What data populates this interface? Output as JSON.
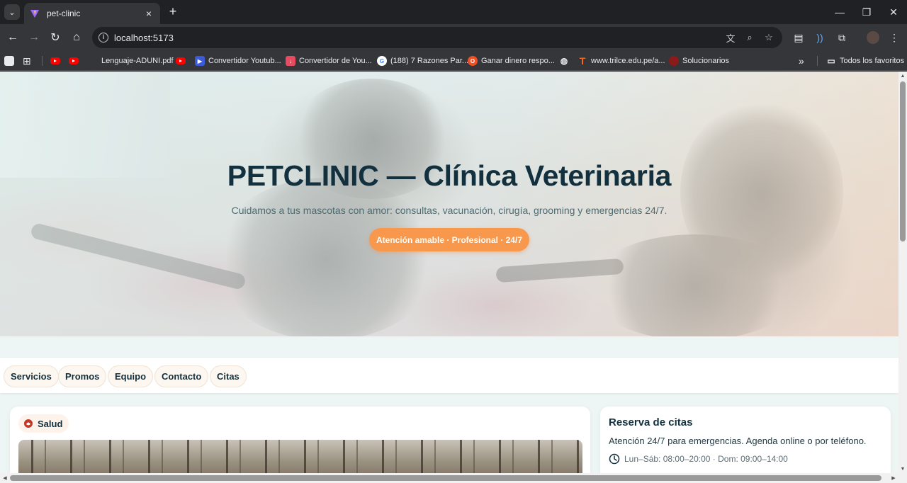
{
  "browser": {
    "tab_title": "pet-clinic",
    "new_tab": "+",
    "url": "localhost:5173",
    "bookmarks": [
      {
        "label": "Lenguaje-ADUNI.pdf"
      },
      {
        "label": "Convertidor Youtub..."
      },
      {
        "label": "Convertidor de You..."
      },
      {
        "label": "(188) 7 Razones Par..."
      },
      {
        "label": "Ganar dinero respo..."
      },
      {
        "label": "www.trilce.edu.pe/a..."
      },
      {
        "label": "Solucionarios"
      }
    ],
    "all_bookmarks": "Todos los favoritos",
    "overflow": "»"
  },
  "hero": {
    "title": "PETCLINIC — Clínica Veterinaria",
    "subtitle": "Cuidamos a tus mascotas con amor: consultas, vacunación, cirugía, grooming y emergencias 24/7.",
    "badge": "Atención amable · Profesional · 24/7"
  },
  "nav": {
    "items": [
      {
        "label": "Servicios"
      },
      {
        "label": "Promos"
      },
      {
        "label": "Equipo"
      },
      {
        "label": "Contacto"
      },
      {
        "label": "Citas"
      }
    ]
  },
  "service_card": {
    "chip": "Salud"
  },
  "booking_card": {
    "title": "Reserva de citas",
    "text": "Atención 24/7 para emergencias. Agenda online o por teléfono.",
    "hours": "Lun–Sáb: 08:00–20:00 · Dom: 09:00–14:00"
  },
  "colors": {
    "accent": "#f7984d",
    "heading": "#12303d",
    "browser_dark": "#202124"
  }
}
